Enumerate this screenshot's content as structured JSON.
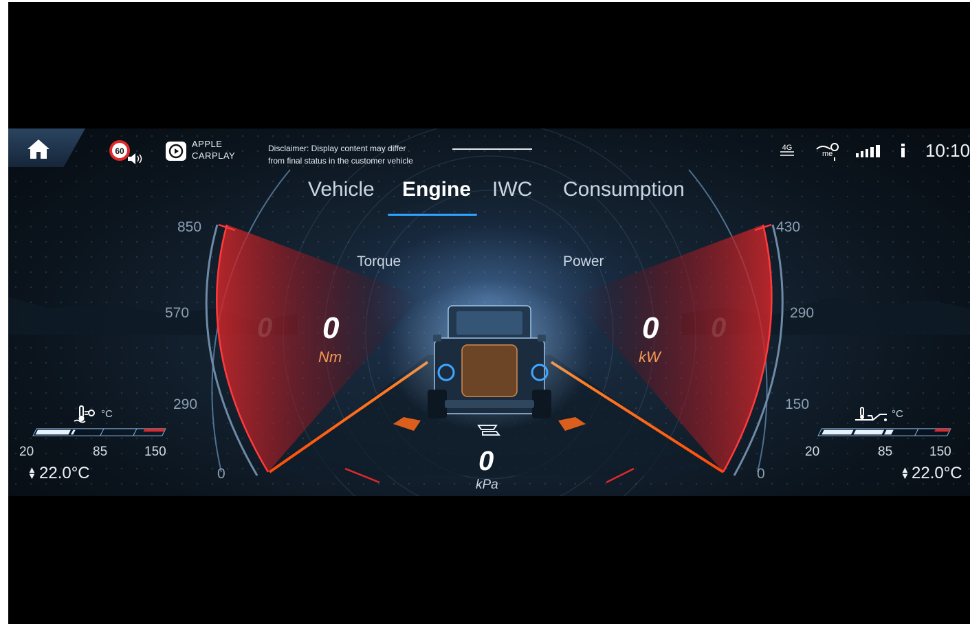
{
  "status_bar": {
    "speed_limit": "60",
    "carplay_label_line1": "APPLE",
    "carplay_label_line2": "CARPLAY",
    "disclaimer_line1": "Disclaimer: Display content may differ",
    "disclaimer_line2": "from final status in the customer vehicle",
    "network_label": "4G",
    "clock": "10:10"
  },
  "tabs": [
    {
      "label": "Vehicle",
      "active": false
    },
    {
      "label": "Engine",
      "active": true
    },
    {
      "label": "IWC",
      "active": false
    },
    {
      "label": "Consumption",
      "active": false
    }
  ],
  "torque_gauge": {
    "label": "Torque",
    "value": "0",
    "unit": "Nm",
    "scale": [
      "850",
      "570",
      "290",
      "0"
    ]
  },
  "power_gauge": {
    "label": "Power",
    "value": "0",
    "unit": "kW",
    "scale": [
      "430",
      "290",
      "150",
      "0"
    ]
  },
  "boost_pressure": {
    "value": "0",
    "unit": "kPa"
  },
  "coolant_temp": {
    "unit": "°C",
    "scale": [
      "20",
      "85",
      "150"
    ],
    "value": "22.0°C"
  },
  "oil_temp": {
    "unit": "°C",
    "scale": [
      "20",
      "85",
      "150"
    ],
    "value": "22.0°C"
  },
  "colors": {
    "accent_blue": "#2ea3ff",
    "gauge_red": "#e0292b",
    "unit_orange": "#f29a54",
    "glow_orange": "#ff6a1a"
  }
}
